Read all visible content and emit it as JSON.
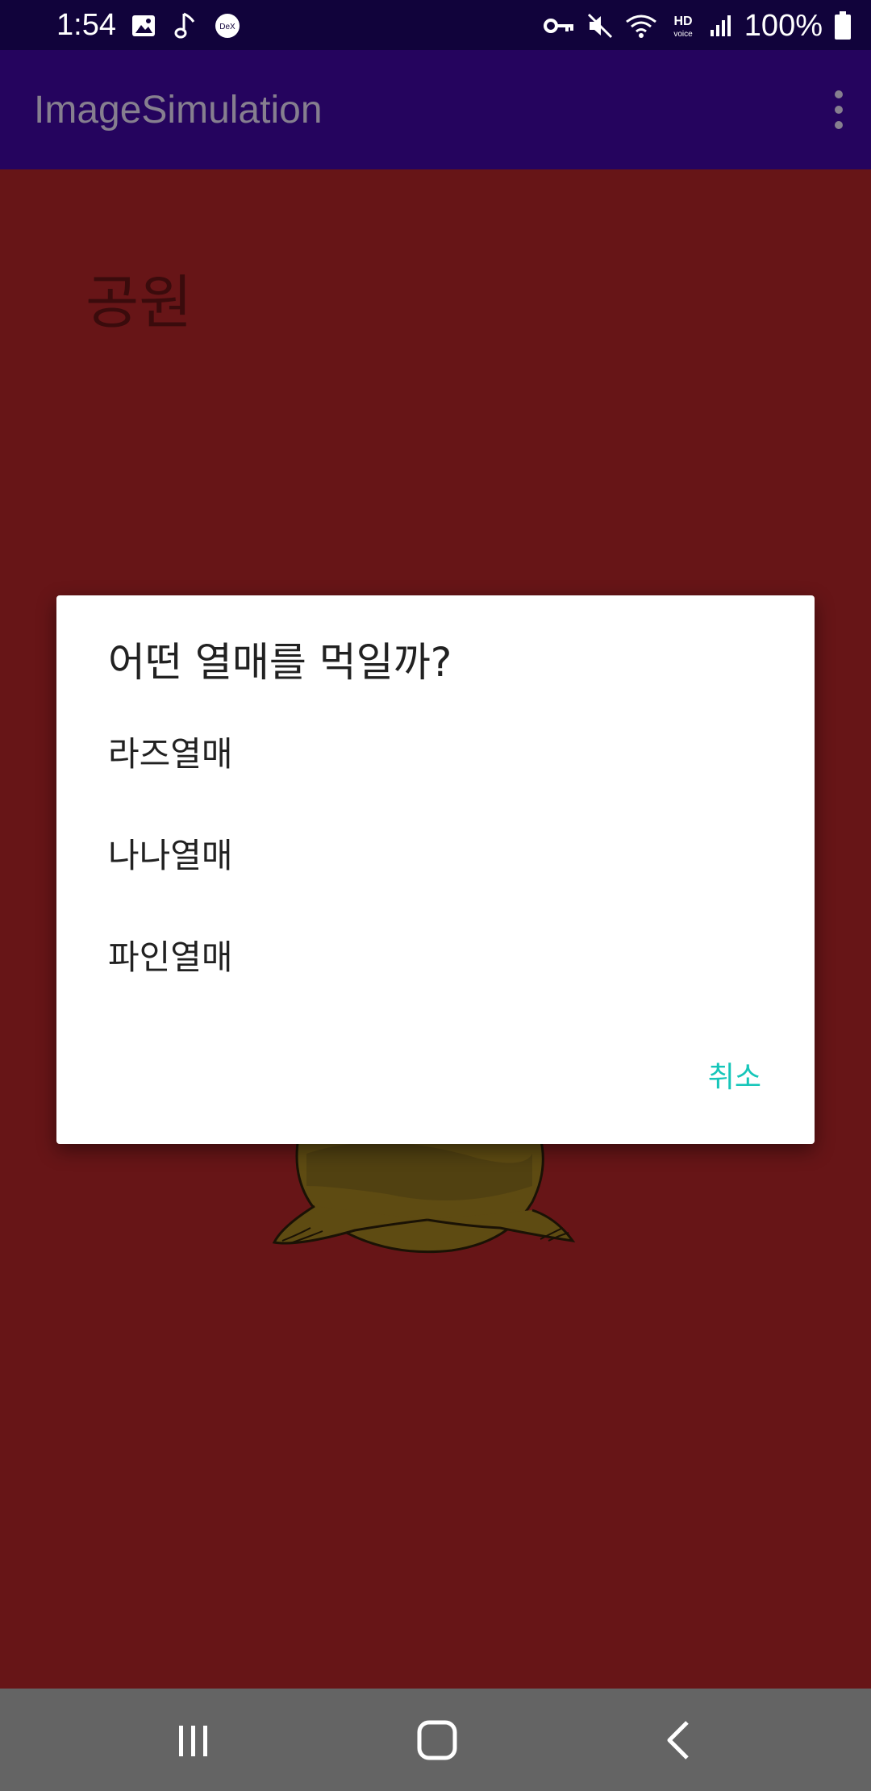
{
  "status_bar": {
    "time": "1:54",
    "battery": "100%",
    "left_icons": [
      "image-icon",
      "music-note-icon",
      "dex-icon"
    ],
    "right_icons": [
      "vpn-key-icon",
      "mute-icon",
      "wifi-icon",
      "hd-voice-icon",
      "signal-icon",
      "battery-icon"
    ],
    "background": "#11033b"
  },
  "app_bar": {
    "title": "ImageSimulation",
    "menu_icon": "overflow-menu-icon",
    "background": "#25045e"
  },
  "content": {
    "place_label": "공원",
    "background": "#671517"
  },
  "dialog": {
    "title": "어떤 열매를 먹일까?",
    "options": [
      "라즈열매",
      "나나열매",
      "파인열매"
    ],
    "cancel_label": "취소",
    "accent": "#15c6b9"
  },
  "nav_bar": {
    "buttons": [
      "recents-icon",
      "home-icon",
      "back-icon"
    ],
    "background": "#646464"
  }
}
